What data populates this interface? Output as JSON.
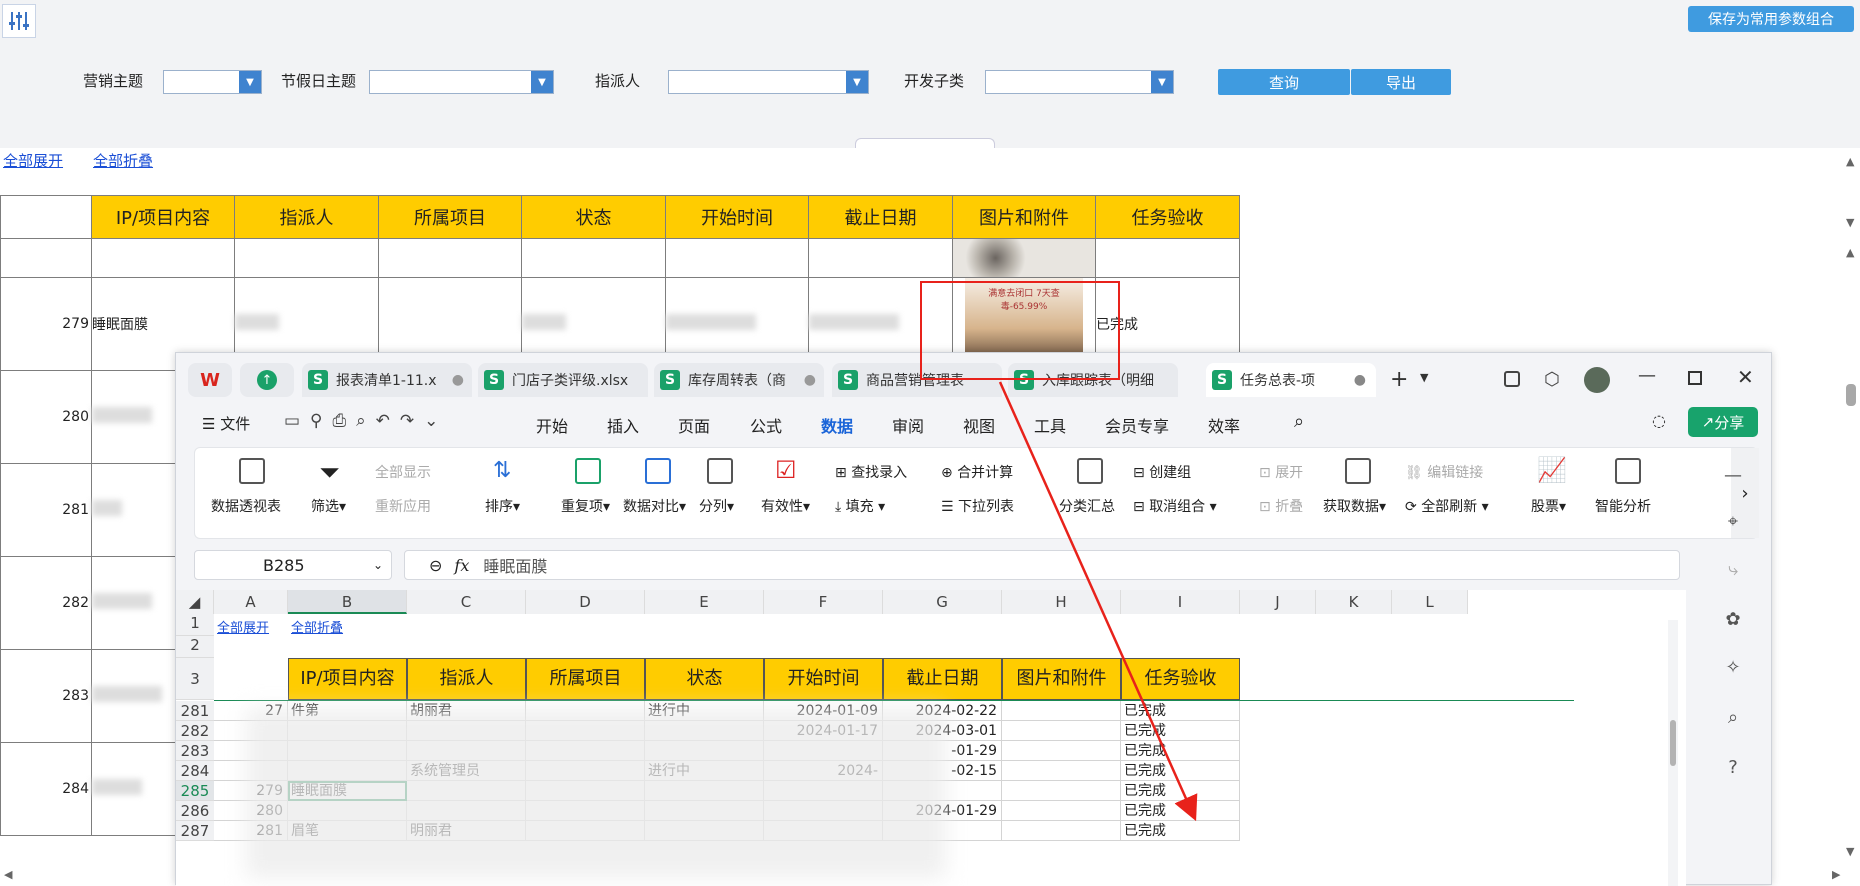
{
  "topbar": {
    "save_combo": "保存为常用参数组合",
    "query": "查询",
    "export": "导出",
    "filters": [
      {
        "label": "营销主题"
      },
      {
        "label": "节假日主题"
      },
      {
        "label": "指派人"
      },
      {
        "label": "开发子类"
      }
    ]
  },
  "links": {
    "expand_all": "全部展开",
    "collapse_all": "全部折叠"
  },
  "report": {
    "headers": [
      "IP/项目内容",
      "指派人",
      "所属项目",
      "状态",
      "开始时间",
      "截止日期",
      "图片和附件",
      "任务验收"
    ],
    "rows": [
      {
        "idx": "",
        "content": "",
        "done": ""
      },
      {
        "idx": "279",
        "content": "睡眠面膜",
        "done": "已完成"
      },
      {
        "idx": "280",
        "content": "",
        "done": ""
      },
      {
        "idx": "281",
        "content": "",
        "done": ""
      },
      {
        "idx": "282",
        "content": "",
        "done": ""
      },
      {
        "idx": "283",
        "content": "",
        "done": ""
      },
      {
        "idx": "284",
        "content": "",
        "done": ""
      }
    ],
    "ad_text": "满意去闭口 7天查毒-65.99%"
  },
  "wps": {
    "tabs": [
      "报表清单1-11.x",
      "门店子类评级.xlsx",
      "库存周转表（商",
      "商品营销管理表",
      "入库跟踪表（明细",
      "任务总表-项"
    ],
    "menus": [
      "文件",
      "开始",
      "插入",
      "页面",
      "公式",
      "数据",
      "审阅",
      "视图",
      "工具",
      "会员专享",
      "效率"
    ],
    "share": "分享",
    "ribbon": {
      "pivot": "数据透视表",
      "filter": "筛选",
      "show_all": "全部显示",
      "reapply": "重新应用",
      "sort": "排序",
      "dup": "重复项",
      "compare": "数据对比",
      "split": "分列",
      "valid": "有效性",
      "lookup": "查找录入",
      "fill": "填充",
      "merge_calc": "合并计算",
      "dropdown": "下拉列表",
      "subtotal": "分类汇总",
      "create_group": "创建组",
      "ungroup": "取消组合",
      "expand": "展开",
      "collapse": "折叠",
      "get_data": "获取数据",
      "edit_links": "编辑链接",
      "refresh_all": "全部刷新",
      "stocks": "股票",
      "smart": "智能分析"
    },
    "namebox": "B285",
    "formula": "睡眠面膜",
    "cols": [
      "A",
      "B",
      "C",
      "D",
      "E",
      "F",
      "G",
      "H",
      "I",
      "J",
      "K",
      "L"
    ],
    "row1": {
      "a": "全部展开",
      "b": "全部折叠"
    },
    "headers": [
      "IP/项目内容",
      "指派人",
      "所属项目",
      "状态",
      "开始时间",
      "截止日期",
      "图片和附件",
      "任务验收"
    ],
    "rows": [
      {
        "r": "281",
        "a": "27",
        "b": "件第",
        "c": "胡丽君",
        "e": "进行中",
        "f": "2024-01-09",
        "g": "2024-02-22",
        "i": "已完成"
      },
      {
        "r": "282",
        "a": "",
        "b": "",
        "c": "",
        "e": "",
        "f": "2024-01-17",
        "g": "2024-03-01",
        "i": "已完成"
      },
      {
        "r": "283",
        "a": "",
        "b": "",
        "c": "",
        "e": "",
        "f": "",
        "g": "-01-29",
        "i": "已完成"
      },
      {
        "r": "284",
        "a": "",
        "b": "",
        "c": "系统管理员",
        "e": "进行中",
        "f": "2024-",
        "g": "-02-15",
        "i": "已完成"
      },
      {
        "r": "285",
        "a": "279",
        "b": "睡眠面膜",
        "c": "",
        "e": "",
        "f": "",
        "g": "",
        "i": "已完成"
      },
      {
        "r": "286",
        "a": "280",
        "b": "",
        "c": "",
        "e": "",
        "f": "",
        "g": "2024-01-29",
        "i": "已完成"
      },
      {
        "r": "287",
        "a": "281",
        "b": "眉笔",
        "c": "明丽君",
        "e": "",
        "f": "",
        "g": "",
        "i": "已完成"
      }
    ]
  }
}
